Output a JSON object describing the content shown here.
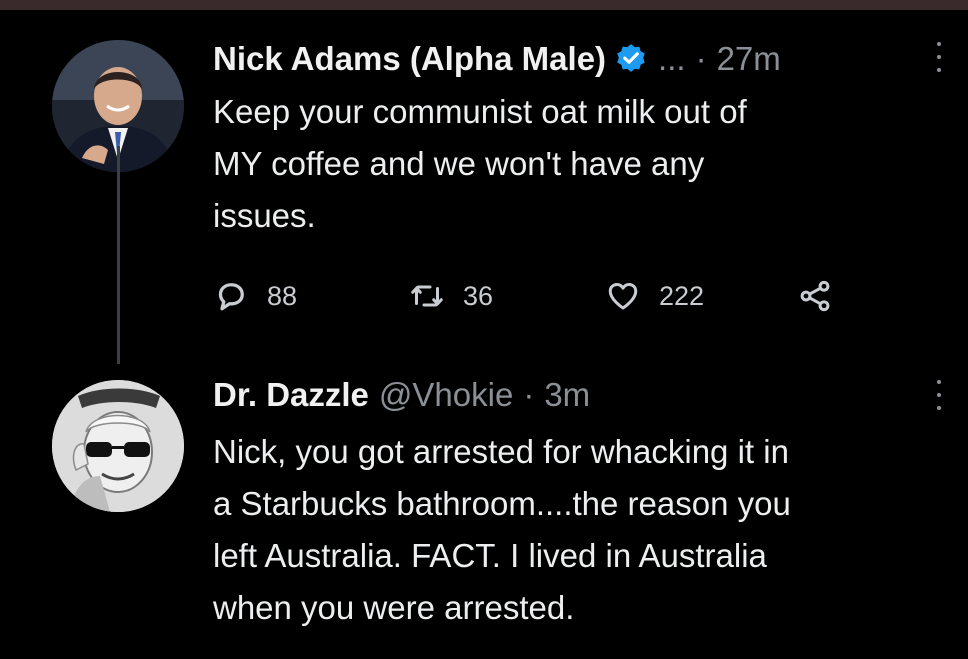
{
  "tweets": [
    {
      "author": "Nick Adams (Alpha Male)",
      "verified": true,
      "handle": "...",
      "time": "27m",
      "text_lines": [
        "Keep your communist oat milk out of",
        "MY coffee and we won't have any",
        "issues."
      ],
      "stats": {
        "replies": "88",
        "retweets": "36",
        "likes": "222"
      }
    },
    {
      "author": "Dr. Dazzle",
      "handle": "@Vhokie",
      "time": "3m",
      "text_lines": [
        "Nick, you got arrested for whacking it in",
        "a Starbucks bathroom....the reason you",
        "left Australia. FACT. I lived in Australia",
        "when you were arrested."
      ]
    }
  ],
  "colors": {
    "background": "#000000",
    "text": "#e7e9ea",
    "muted": "#8b9096",
    "verified": "#1d9bf0"
  },
  "icons": [
    "verified-badge-icon",
    "more-options-icon",
    "reply-icon",
    "retweet-icon",
    "like-icon",
    "share-icon"
  ]
}
